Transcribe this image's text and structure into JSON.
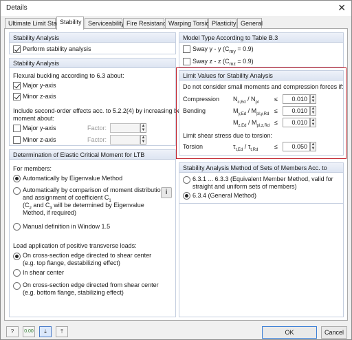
{
  "window": {
    "title": "Details",
    "close_glyph": "✕"
  },
  "tabs": [
    {
      "label": "Ultimate Limit State"
    },
    {
      "label": "Stability"
    },
    {
      "label": "Serviceability"
    },
    {
      "label": "Fire Resistance"
    },
    {
      "label": "Warping Torsion"
    },
    {
      "label": "Plasticity"
    },
    {
      "label": "General"
    }
  ],
  "stability_analysis": {
    "header": "Stability Analysis",
    "perform_label": "Perform stability analysis",
    "perform_checked": true
  },
  "model_type": {
    "header": "Model Type According to Table B.3",
    "sway_y_label": "Sway y - y (C",
    "sway_y_sub": "my",
    "sway_y_suffix": " = 0.9)",
    "sway_z_label": "Sway z - z (C",
    "sway_z_sub": "mz",
    "sway_z_suffix": " = 0.9)"
  },
  "stability_analysis_2": {
    "header": "Stability Analysis",
    "flexural_text": "Flexural buckling according to 6.3 about:",
    "major_label": "Major y-axis",
    "minor_label": "Minor z-axis",
    "include_text_1": "Include second-order effects acc. to 5.2.2(4) by increasing bending",
    "include_text_2": "moment about:",
    "major2_label": "Major y-axis",
    "minor2_label": "Minor z-axis",
    "factor_label": "Factor:"
  },
  "limit_values": {
    "header": "Limit Values for Stability Analysis",
    "intro": "Do not consider small moments and compression forces if:",
    "compression_label": "Compression",
    "compression_formula": "N",
    "compression_formula_sub": "c,Ed",
    "compression_formula_mid": " / N",
    "compression_formula_sub2": "pl",
    "compression_op": "≤",
    "compression_value": "0.010",
    "bending_label": "Bending",
    "my_formula": "M",
    "my_sub": "y,Ed",
    "my_mid": " / M",
    "my_sub2": "pl,y,Rd",
    "my_op": "≤",
    "my_value": "0.010",
    "mz_formula": "M",
    "mz_sub": "z,Ed",
    "mz_mid": " / M",
    "mz_sub2": "pl,z,Rd",
    "mz_op": "≤",
    "mz_value": "0.010",
    "shear_text": "Limit shear stress due to torsion:",
    "torsion_label": "Torsion",
    "torsion_formula": "τ",
    "torsion_sub": "t,Ed",
    "torsion_mid": " / τ",
    "torsion_sub2": "t,Rd",
    "torsion_op": "≤",
    "torsion_value": "0.050"
  },
  "elastic_moment": {
    "header": "Determination of Elastic Critical Moment for LTB",
    "for_members": "For members:",
    "opt1": "Automatically by Eigenvalue Method",
    "opt2_l1": "Automatically by comparison of moment distribution",
    "opt2_l2": "and assignment of coefficient C",
    "opt2_l2_sub": "1",
    "opt2_l3": "(C",
    "opt2_l3_sub1": "2",
    "opt2_l3_mid": " and C",
    "opt2_l3_sub2": "3",
    "opt2_l3_end": " will be determined by Eigenvalue",
    "opt2_l4": "Method, if required)",
    "opt3": "Manual definition in Window 1.5",
    "load_text": "Load application of positive transverse loads:",
    "load1_l1": "On cross-section edge directed to shear center",
    "load1_l2": "(e.g. top flange, destabilizing effect)",
    "load2": "In shear center",
    "load3_l1": "On cross-section edge directed from shear center",
    "load3_l2": "(e.g. bottom flange, stabilizing effect)"
  },
  "sets_method": {
    "header": "Stability Analysis Method of Sets of Members Acc. to",
    "opt1_l1": "6.3.1 ... 6.3.3 (Equivalent Member Method, valid for",
    "opt1_l2": "straight and uniform sets of members)",
    "opt2": "6.3.4 (General Method)"
  },
  "footer": {
    "ok_label": "OK",
    "cancel_label": "Cancel",
    "zero_btn": "0.00"
  },
  "colors": {
    "highlight_frame": "#c0202a",
    "group_header": "#dde5f2",
    "default_button_border": "#3c7fd6"
  }
}
